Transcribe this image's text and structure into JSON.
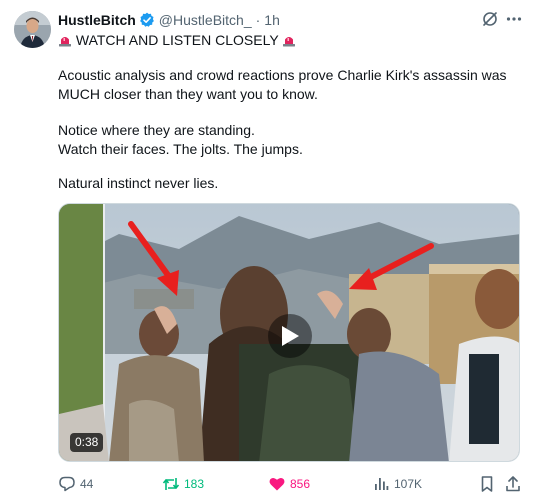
{
  "author": {
    "display_name": "HustleBitch",
    "handle": "@HustleBitch_",
    "separator": "·",
    "time": "1h",
    "verified": true
  },
  "post": {
    "lines": [
      "WATCH AND LISTEN CLOSELY",
      "Acoustic analysis and crowd reactions prove Charlie Kirk's assassin was",
      "MUCH closer than they want you to know.",
      "Notice where they are standing.",
      "Watch their faces. The jolts. The jumps.",
      "Natural instinct never lies."
    ],
    "emoji": "rotating-light-emoji"
  },
  "media": {
    "type": "video",
    "duration": "0:38"
  },
  "actions": {
    "replies": "44",
    "reposts": "183",
    "likes": "856",
    "views": "107K"
  },
  "colors": {
    "text": "#0f1419",
    "secondary": "#536471",
    "verified": "#1d9bf0",
    "repost": "#00ba7c",
    "like": "#f91880",
    "arrow": "#e8201e"
  },
  "icons": [
    "grok-icon",
    "more-icon",
    "reply-icon",
    "repost-icon",
    "heart-icon",
    "views-icon",
    "bookmark-icon",
    "share-icon",
    "play-icon"
  ]
}
